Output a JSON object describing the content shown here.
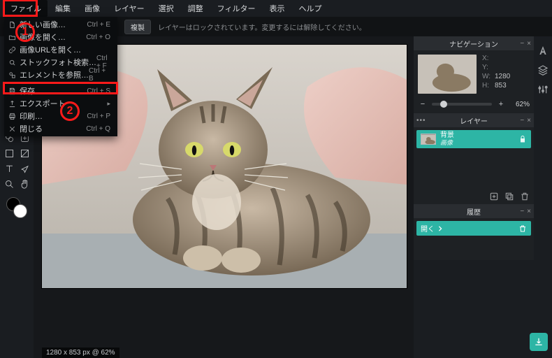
{
  "menubar": {
    "items": [
      "ファイル",
      "編集",
      "画像",
      "レイヤー",
      "選択",
      "調整",
      "フィルター",
      "表示",
      "ヘルプ"
    ]
  },
  "file_menu": {
    "items": [
      {
        "label": "新しい画像…",
        "shortcut": "Ctrl + E",
        "icon": "file-new"
      },
      {
        "label": "画像を開く…",
        "shortcut": "Ctrl + O",
        "icon": "folder-open"
      },
      {
        "label": "画像URLを開く…",
        "shortcut": "",
        "icon": "link"
      },
      {
        "label": "ストックフォト検索…",
        "shortcut": "Ctrl + F",
        "icon": "search"
      },
      {
        "label": "エレメントを参照…",
        "shortcut": "Ctrl + B",
        "icon": "shapes"
      },
      {
        "sep": true
      },
      {
        "label": "保存…",
        "shortcut": "Ctrl + S",
        "icon": "save",
        "highlight": true
      },
      {
        "label": "エクスポート",
        "shortcut": "",
        "icon": "export",
        "submenu": true
      },
      {
        "label": "印刷…",
        "shortcut": "Ctrl + P",
        "icon": "print"
      },
      {
        "label": "閉じる",
        "shortcut": "Ctrl + Q",
        "icon": "close"
      }
    ]
  },
  "toolbar": {
    "duplicate_label": "複製",
    "lock_msg": "レイヤーはロックされています。変更するには解除してください。"
  },
  "annotations": {
    "one": "1",
    "two": "2"
  },
  "tools": [
    [
      "layout",
      "crop"
    ],
    [
      "move",
      "wand"
    ],
    [
      "lasso",
      "marquee"
    ],
    [
      "target",
      "fill"
    ],
    [
      "brush",
      "pencil"
    ],
    [
      "eraser",
      "smudge"
    ],
    [
      "clone",
      "heal"
    ],
    [
      "shape",
      "gradient"
    ],
    [
      "text",
      "pen"
    ],
    [
      "zoom",
      "hand"
    ]
  ],
  "nav": {
    "title": "ナビゲーション",
    "x_label": "X:",
    "y_label": "Y:",
    "w_label": "W:",
    "h_label": "H:",
    "x": "",
    "y": "",
    "w": "1280",
    "h": "853",
    "zoom": "62%"
  },
  "layers": {
    "title": "レイヤー",
    "items": [
      {
        "name": "背景",
        "type": "画像"
      }
    ]
  },
  "history": {
    "title": "履歴",
    "items": [
      {
        "label": "開く"
      }
    ]
  },
  "status": {
    "text": "1280 x 853 px @ 62%"
  }
}
